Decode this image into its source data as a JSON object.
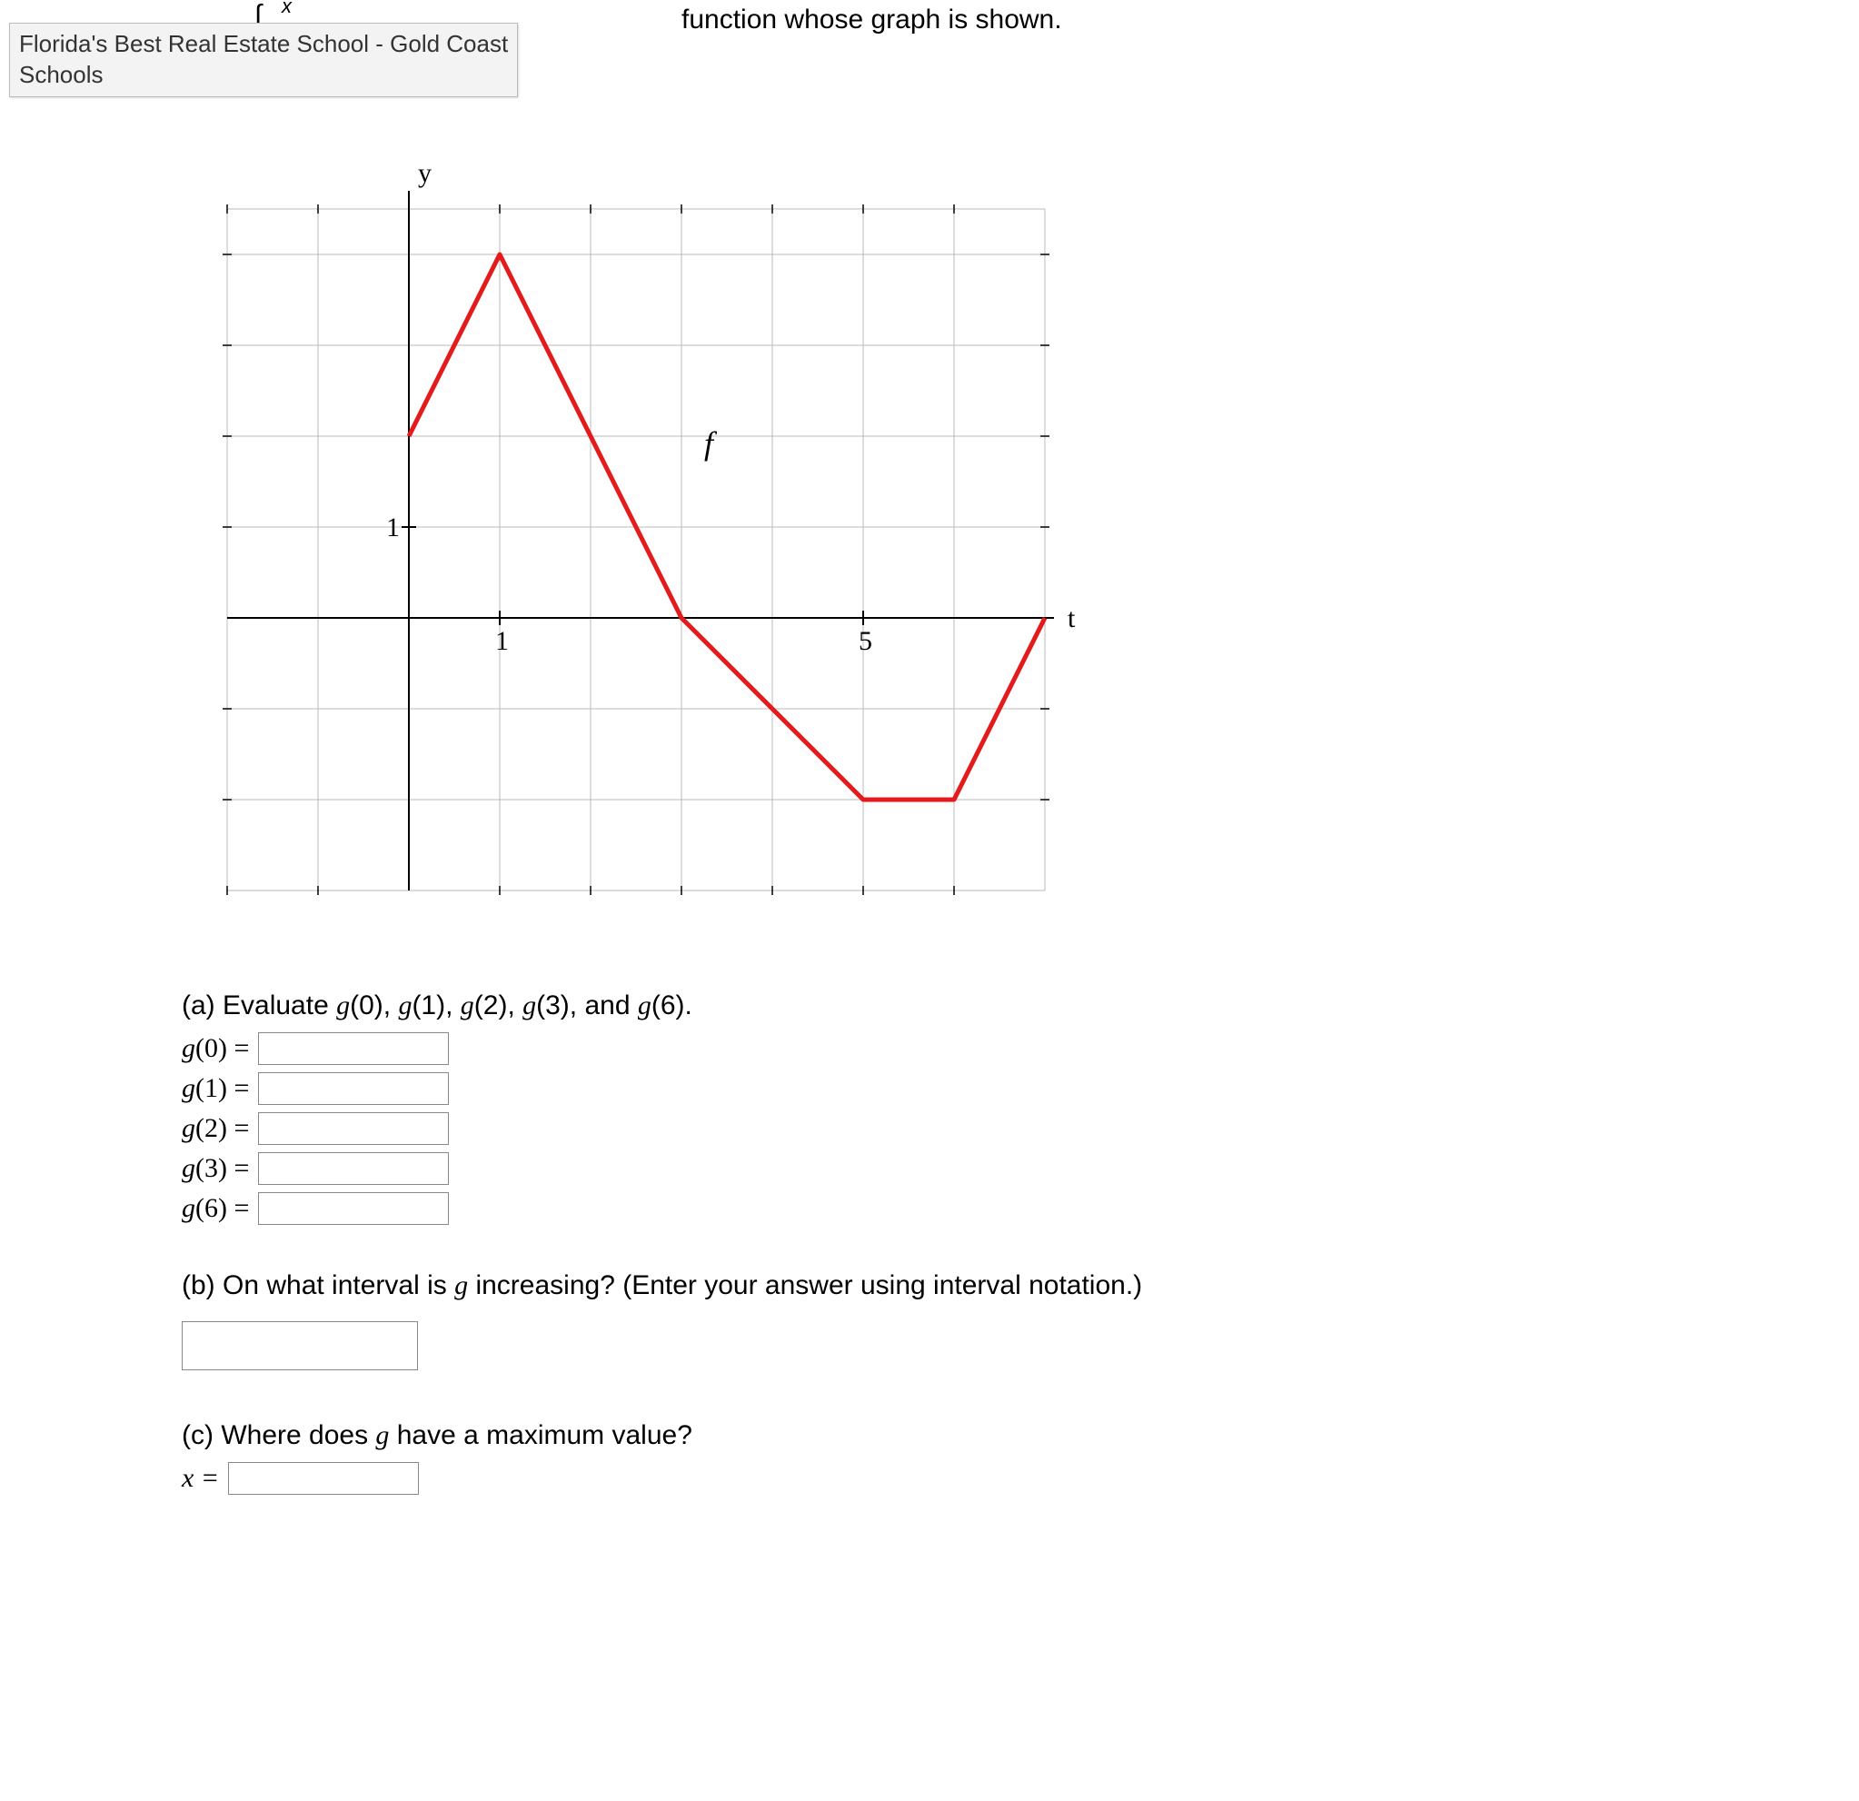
{
  "tooltip": {
    "line1": "Florida's Best Real Estate School - Gold Coast",
    "line2": "Schools"
  },
  "fragments": {
    "integral": "∫",
    "x": "x",
    "tail": " function whose graph is shown."
  },
  "chart_data": {
    "type": "line",
    "title": "",
    "xlabel": "t",
    "ylabel": "y",
    "xlim": [
      -2,
      7
    ],
    "ylim": [
      -3,
      5
    ],
    "x_ticks": [
      1,
      5
    ],
    "y_ticks": [
      1
    ],
    "curve_label": "f",
    "series": [
      {
        "name": "f",
        "x": [
          0,
          1,
          2,
          3,
          5,
          6,
          7
        ],
        "y": [
          2,
          4,
          2,
          0,
          -2,
          -2,
          0
        ]
      }
    ]
  },
  "parts": {
    "a": {
      "prompt": "(a) Evaluate g(0), g(1), g(2), g(3), and g(6).",
      "rows": [
        {
          "label_g": "g",
          "label_inner": "(0) =",
          "value": ""
        },
        {
          "label_g": "g",
          "label_inner": "(1) =",
          "value": ""
        },
        {
          "label_g": "g",
          "label_inner": "(2) =",
          "value": ""
        },
        {
          "label_g": "g",
          "label_inner": "(3) =",
          "value": ""
        },
        {
          "label_g": "g",
          "label_inner": "(6) =",
          "value": ""
        }
      ]
    },
    "b": {
      "prompt_pre": "(b) On what interval is ",
      "prompt_g": "g",
      "prompt_post": " increasing? (Enter your answer using interval notation.)",
      "value": ""
    },
    "c": {
      "prompt_pre": "(c) Where does ",
      "prompt_g": "g",
      "prompt_post": " have a maximum value?",
      "x_label": "x =",
      "value": ""
    }
  }
}
